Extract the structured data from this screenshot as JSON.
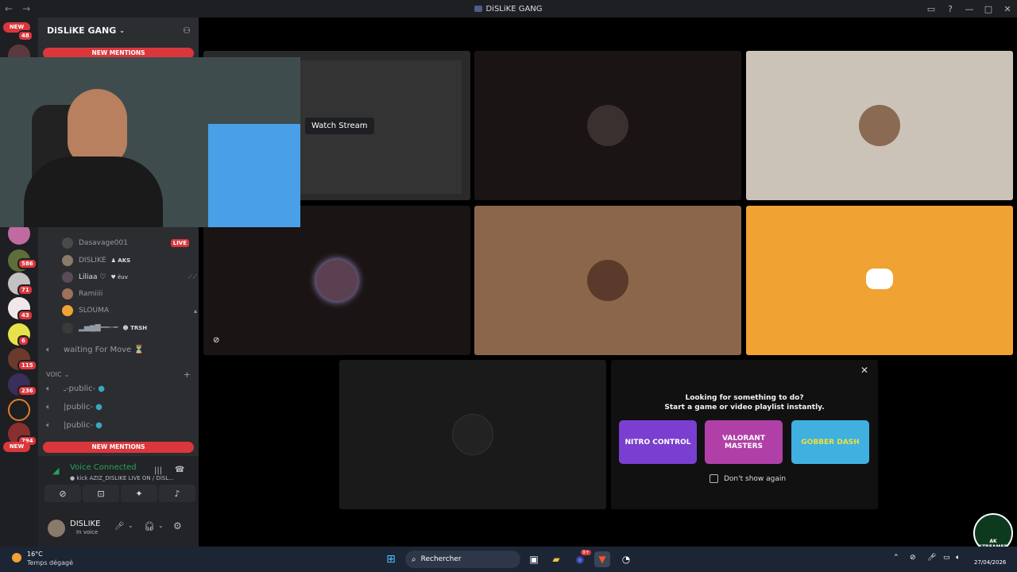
{
  "window": {
    "title": "DiSLiKE GANG",
    "back": "←",
    "forward": "→",
    "help": "?"
  },
  "guild_list": {
    "new_label": "NEW",
    "badges": [
      "48",
      "586",
      "71",
      "43",
      "6",
      "115",
      "236",
      "794"
    ]
  },
  "server": {
    "name": "DiSLiKE GANG",
    "new_mentions": "NEW MENTIONS",
    "voice_users": [
      {
        "name": "Dasavage001",
        "badge": "LIVE"
      },
      {
        "name": "DISLIKE",
        "tag": "AKS"
      },
      {
        "name": "Liliaa ♡",
        "tag": "ёuv"
      },
      {
        "name": "Ramiiii"
      },
      {
        "name": "SLOUMA"
      },
      {
        "name": "▂▅▆▇━━─━",
        "tag": "TRSH"
      }
    ],
    "channels_top": [
      {
        "name": "waiting For Move ⏳"
      }
    ],
    "voice_category": "VOIC",
    "voice_channels": [
      {
        "name": "ـ-public-"
      },
      {
        "name": "|public-"
      },
      {
        "name": "|public-"
      }
    ]
  },
  "voice_status": {
    "title": "Voice Connected",
    "subtitle": "kick AZIZ_DISLIKE LIVE ON / DiSL..."
  },
  "user": {
    "name": "DISLIKE",
    "status": "In voice"
  },
  "stage": {
    "watch_stream": "Watch Stream",
    "activity_title": "Looking for something to do?",
    "activity_subtitle": "Start a game or video playlist instantly.",
    "games": [
      "NITRO CONTROL",
      "VALORANT MASTERS",
      "GOBBER DASH"
    ],
    "dont_show": "Don't show again"
  },
  "taskbar": {
    "temp": "16°C",
    "weather": "Temps dégagé",
    "search": "Rechercher",
    "date": "27/04/2026",
    "notif": "9+"
  },
  "watermark": "AK STREAMER"
}
